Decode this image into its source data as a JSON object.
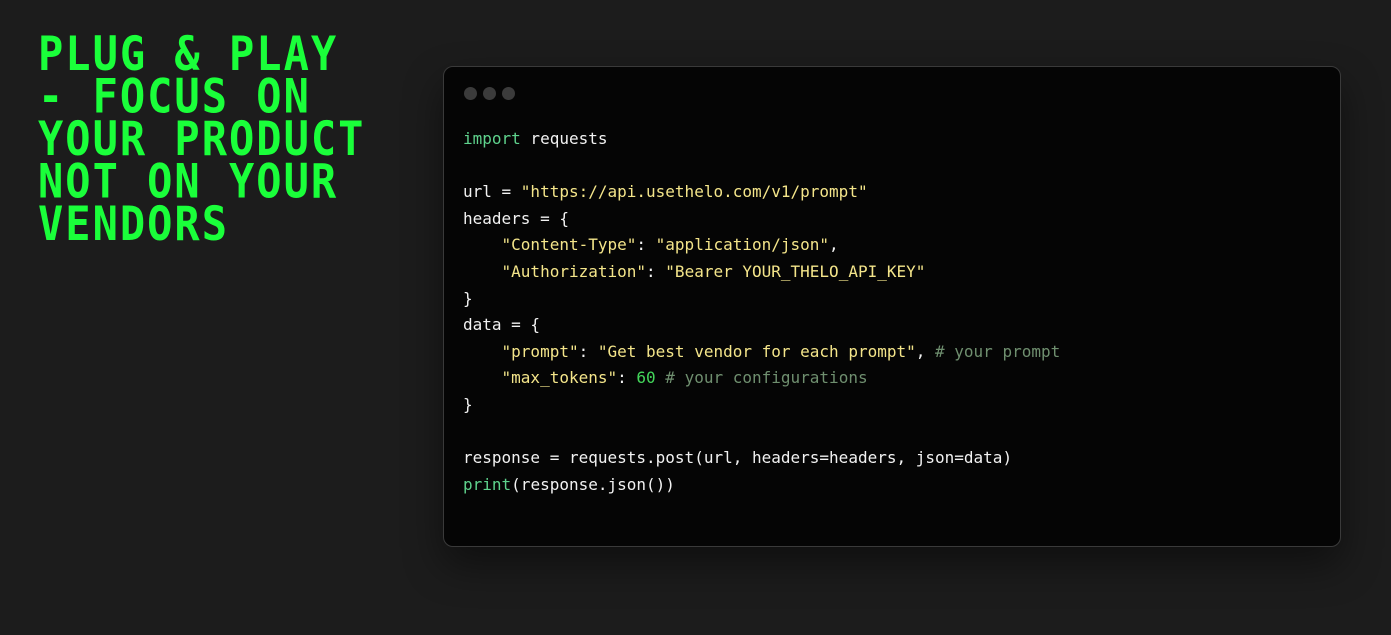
{
  "headline": {
    "lines": [
      "PLUG & PLAY",
      "- FOCUS ON",
      "YOUR PRODUCT",
      "NOT ON YOUR",
      "VENDORS"
    ]
  },
  "code_window": {
    "lines": [
      [
        {
          "t": "kw",
          "v": "import"
        },
        {
          "t": "pl",
          "v": " requests"
        }
      ],
      [],
      [
        {
          "t": "pl",
          "v": "url = "
        },
        {
          "t": "str",
          "v": "\"https://api.usethelo.com/v1/prompt\""
        }
      ],
      [
        {
          "t": "pl",
          "v": "headers = {"
        }
      ],
      [
        {
          "t": "pl",
          "v": "    "
        },
        {
          "t": "str",
          "v": "\"Content-Type\""
        },
        {
          "t": "pl",
          "v": ": "
        },
        {
          "t": "str",
          "v": "\"application/json\""
        },
        {
          "t": "pl",
          "v": ","
        }
      ],
      [
        {
          "t": "pl",
          "v": "    "
        },
        {
          "t": "str",
          "v": "\"Authorization\""
        },
        {
          "t": "pl",
          "v": ": "
        },
        {
          "t": "str",
          "v": "\"Bearer YOUR_THELO_API_KEY\""
        }
      ],
      [
        {
          "t": "pl",
          "v": "}"
        }
      ],
      [
        {
          "t": "pl",
          "v": "data = {"
        }
      ],
      [
        {
          "t": "pl",
          "v": "    "
        },
        {
          "t": "str",
          "v": "\"prompt\""
        },
        {
          "t": "pl",
          "v": ": "
        },
        {
          "t": "str",
          "v": "\"Get best vendor for each prompt\""
        },
        {
          "t": "pl",
          "v": ", "
        },
        {
          "t": "cm",
          "v": "# your prompt"
        }
      ],
      [
        {
          "t": "pl",
          "v": "    "
        },
        {
          "t": "str",
          "v": "\"max_tokens\""
        },
        {
          "t": "pl",
          "v": ": "
        },
        {
          "t": "num",
          "v": "60"
        },
        {
          "t": "pl",
          "v": " "
        },
        {
          "t": "cm",
          "v": "# your configurations"
        }
      ],
      [
        {
          "t": "pl",
          "v": "}"
        }
      ],
      [],
      [
        {
          "t": "pl",
          "v": "response = requests.post(url, headers=headers, json=data)"
        }
      ],
      [
        {
          "t": "fn",
          "v": "print"
        },
        {
          "t": "pl",
          "v": "(response.json())"
        }
      ]
    ]
  },
  "colors": {
    "headline": "#1aff3a",
    "background": "#1c1c1c",
    "code_background": "#050505",
    "keyword": "#5fd38d",
    "string": "#f4e58a",
    "number": "#43d65a",
    "comment": "#6f8f6f"
  }
}
